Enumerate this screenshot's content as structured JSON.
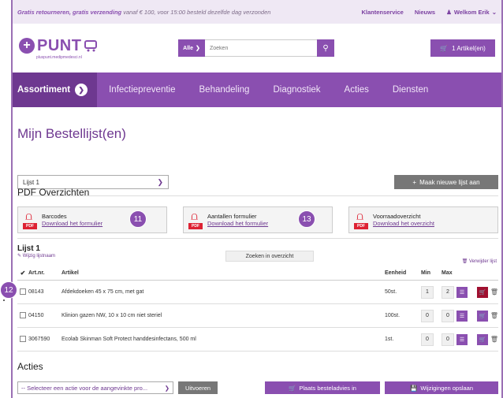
{
  "topbar": {
    "promo_bold": "Gratis retourneren, gratis verzending",
    "promo_rest": " vanaf € 100, voor 15:00 besteld dezelfde dag verzonden",
    "links": [
      "Klantenservice",
      "Nieuws",
      "Welkom Erik"
    ]
  },
  "logo": {
    "text": "PUNT",
    "sub": "pluspunt.medipmedesci.nl"
  },
  "search": {
    "category": "Alle",
    "placeholder": "Zoeken"
  },
  "cart": {
    "label": "1 Artikel(en)"
  },
  "nav": {
    "items": [
      "Assortiment",
      "Infectiepreventie",
      "Behandeling",
      "Diagnostiek",
      "Acties",
      "Diensten"
    ]
  },
  "page": {
    "title": "Mijn Bestellijst(en)"
  },
  "list_select": {
    "value": "Lijst 1"
  },
  "new_list_button": "Maak nieuwe lijst aan",
  "pdf": {
    "title": "PDF Overzichten",
    "cards": [
      {
        "title": "Barcodes",
        "link": "Download het formulier"
      },
      {
        "title": "Aantallen formulier",
        "link": "Download het formulier"
      },
      {
        "title": "Voorraadoverzicht",
        "link": "Download het overzicht"
      }
    ]
  },
  "bubbles": [
    "11",
    "13",
    "12"
  ],
  "list": {
    "title": "Lijst 1",
    "edit": "Wijzig lijstnaam",
    "filter": "Zoeken in overzicht",
    "remove": "Verwijder lijst",
    "columns": {
      "art": "Art.nr.",
      "name": "Artikel",
      "unit": "Eenheid",
      "min": "Min",
      "max": "Max"
    },
    "rows": [
      {
        "art": "08143",
        "name": "Afdekdoeken 45 x 75 cm, met gat",
        "unit": "50st.",
        "min": "1",
        "max": "2"
      },
      {
        "art": "04150",
        "name": "Klinion gazen NW, 10 x 10 cm niet steriel",
        "unit": "100st.",
        "min": "0",
        "max": "0"
      },
      {
        "art": "3067590",
        "name": "Ecolab Skinman Soft Protect handdesinfectans, 500 ml",
        "unit": "1st.",
        "min": "0",
        "max": "0"
      }
    ]
  },
  "acties": {
    "title": "Acties",
    "select": "-- Selecteer een actie voor de aangevinkte pro...",
    "execute": "Uitvoeren",
    "advice": "Plaats besteladvies in",
    "save": "Wijzigingen opslaan"
  },
  "colors": {
    "brand": "#8a4fb0",
    "brand_dark": "#6e3890",
    "danger": "#a01030"
  }
}
